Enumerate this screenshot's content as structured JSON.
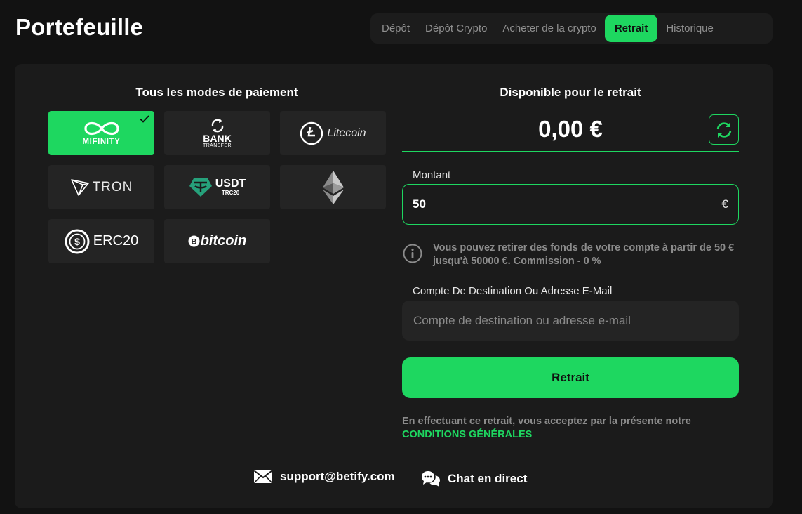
{
  "page": {
    "title": "Portefeuille"
  },
  "tabs": [
    {
      "label": "Dépôt",
      "active": false
    },
    {
      "label": "Dépôt Crypto",
      "active": false
    },
    {
      "label": "Acheter de la crypto",
      "active": false
    },
    {
      "label": "Retrait",
      "active": true
    },
    {
      "label": "Historique",
      "active": false
    }
  ],
  "payment": {
    "title": "Tous les modes de paiement",
    "methods": [
      {
        "name": "MiFinity",
        "logo_text": "MIFINITY",
        "icon": "infinity-icon",
        "selected": true
      },
      {
        "name": "Bank Transfer",
        "logo_text": "BANK",
        "logo_subtext": "TRANSFER",
        "icon": "bank-transfer-icon",
        "selected": false
      },
      {
        "name": "Litecoin",
        "logo_text": "Litecoin",
        "icon": "litecoin-icon",
        "selected": false
      },
      {
        "name": "Tron",
        "logo_text": "TRON",
        "icon": "tron-icon",
        "selected": false
      },
      {
        "name": "USDT",
        "logo_text": "USDT",
        "logo_subtext": "TRC20",
        "icon": "tether-icon",
        "selected": false
      },
      {
        "name": "Ethereum",
        "icon": "ethereum-icon",
        "selected": false
      },
      {
        "name": "ERC20",
        "logo_text": "ERC20",
        "icon": "usd-coin-icon",
        "selected": false
      },
      {
        "name": "Bitcoin",
        "logo_text": "bitcoin",
        "icon": "bitcoin-icon",
        "selected": false
      }
    ]
  },
  "withdraw": {
    "available_title": "Disponible pour le retrait",
    "balance": "0,00 €",
    "amount_label": "Montant",
    "amount_value": "50",
    "currency_symbol": "€",
    "info_text": "Vous pouvez retirer des fonds de votre compte à partir de 50 € jusqu'à 50000 €. Commission - 0 %",
    "destination_label": "Compte De Destination Ou Adresse E-Mail",
    "destination_placeholder": "Compte de destination ou adresse e-mail",
    "destination_value": "",
    "submit_label": "Retrait",
    "terms_text": "En effectuant ce retrait, vous acceptez par la présente notre",
    "terms_link": "CONDITIONS GÉNÉRALES"
  },
  "footer": {
    "support_email": "support@betify.com",
    "chat_label": "Chat en direct"
  },
  "colors": {
    "accent": "#1ed760",
    "background": "#121212",
    "card": "#1b1b1b",
    "tile": "#242424"
  }
}
